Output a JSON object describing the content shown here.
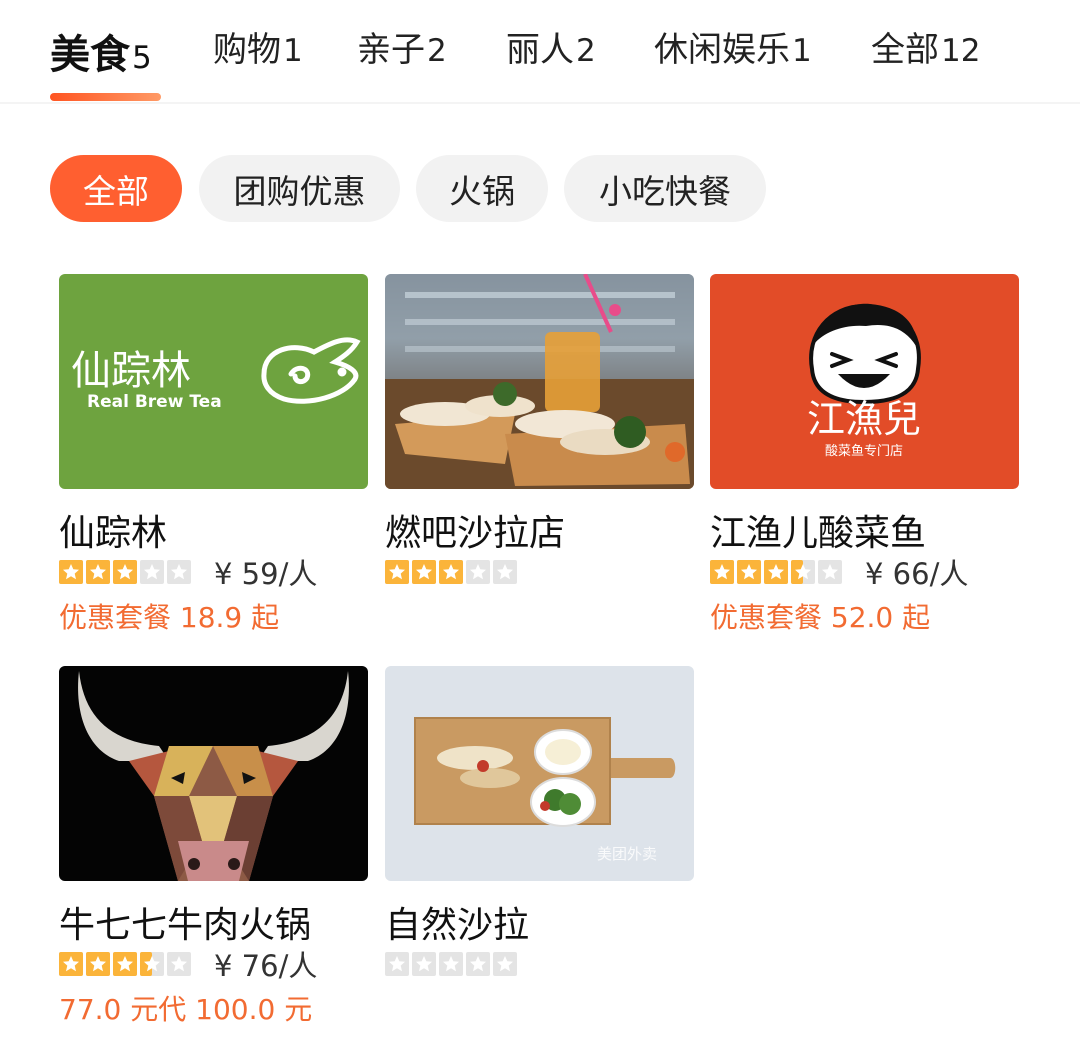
{
  "tabs": [
    {
      "label": "美食",
      "count": "5",
      "active": true
    },
    {
      "label": "购物",
      "count": "1"
    },
    {
      "label": "亲子",
      "count": "2"
    },
    {
      "label": "丽人",
      "count": "2"
    },
    {
      "label": "休闲娱乐",
      "count": "1"
    },
    {
      "label": "全部",
      "count": "12"
    }
  ],
  "filters": [
    {
      "label": "全部",
      "active": true
    },
    {
      "label": "团购优惠"
    },
    {
      "label": "火锅"
    },
    {
      "label": "小吃快餐"
    }
  ],
  "shops": [
    {
      "name": "仙踪林",
      "rating": 3,
      "price": "¥ 59/人",
      "promo": "优惠套餐 18.9 起",
      "logo_text": "仙踪林",
      "logo_subtext": "Real Brew Tea"
    },
    {
      "name": "燃吧沙拉店",
      "rating": 3,
      "price": "",
      "promo": ""
    },
    {
      "name": "江渔儿酸菜鱼",
      "rating": 3.5,
      "price": "¥ 66/人",
      "promo": "优惠套餐 52.0 起",
      "logo_text": "江漁兒",
      "logo_subtext": "酸菜鱼专门店"
    },
    {
      "name": "牛七七牛肉火锅",
      "rating": 3.5,
      "price": "¥ 76/人",
      "promo": "77.0 元代 100.0 元"
    },
    {
      "name": "自然沙拉",
      "rating": 0,
      "price": "",
      "promo": "",
      "watermark": "美团外卖"
    }
  ],
  "colors": {
    "accent": "#ff5f30",
    "star": "#fbb43a",
    "star_empty": "#e4e4e4",
    "promo": "#f26b32"
  }
}
